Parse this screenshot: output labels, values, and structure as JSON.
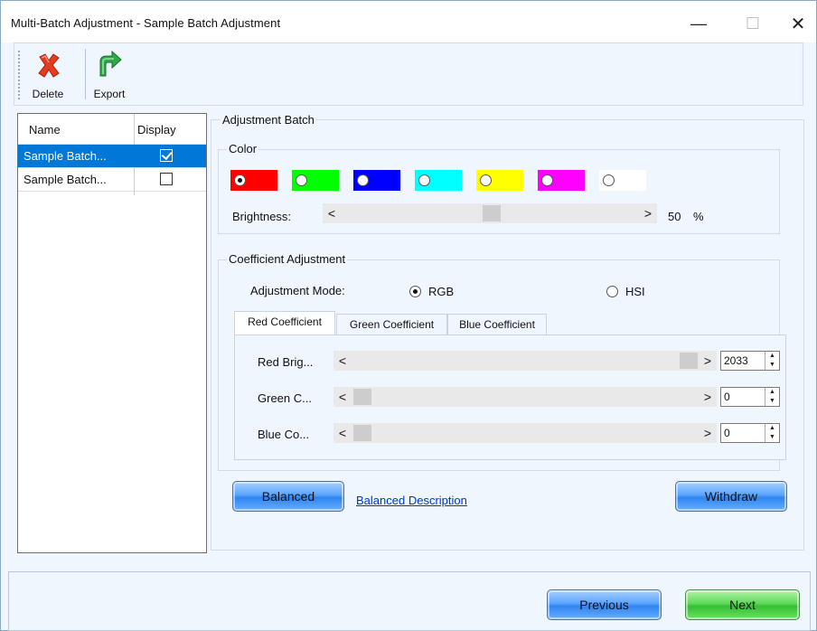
{
  "window": {
    "title": "Multi-Batch Adjustment - Sample Batch Adjustment",
    "min_glyph": "—",
    "max_glyph": "☐",
    "close_glyph": "✕"
  },
  "toolbar": {
    "delete_label": "Delete",
    "export_label": "Export"
  },
  "batch_list": {
    "col_name": "Name",
    "col_display": "Display",
    "rows": [
      {
        "name": "Sample Batch...",
        "display": true,
        "selected": true
      },
      {
        "name": "Sample Batch...",
        "display": false,
        "selected": false
      }
    ]
  },
  "adjustment_batch": {
    "title": "Adjustment Batch",
    "color": {
      "title": "Color",
      "swatches": [
        {
          "color": "#ff0000",
          "selected": true
        },
        {
          "color": "#00ff00",
          "selected": false
        },
        {
          "color": "#0000ff",
          "selected": false
        },
        {
          "color": "#00ffff",
          "selected": false
        },
        {
          "color": "#ffff00",
          "selected": false
        },
        {
          "color": "#ff00ff",
          "selected": false
        },
        {
          "color": "#ffffff",
          "selected": false
        }
      ],
      "brightness_label": "Brightness:",
      "brightness_value": "50",
      "brightness_unit": "%"
    },
    "coefficient": {
      "title": "Coefficient Adjustment",
      "mode_label": "Adjustment Mode:",
      "mode_rgb": "RGB",
      "mode_hsi": "HSI",
      "mode_selected": "RGB",
      "tabs": [
        "Red Coefficient",
        "Green Coefficient",
        "Blue Coefficient"
      ],
      "active_tab": 0,
      "rows": [
        {
          "label": "Red Brig...",
          "value": "2033"
        },
        {
          "label": "Green C...",
          "value": "0"
        },
        {
          "label": "Blue Co...",
          "value": "0"
        }
      ]
    },
    "balanced_label": "Balanced",
    "balanced_description": "Balanced Description",
    "withdraw_label": "Withdraw"
  },
  "footer": {
    "previous_label": "Previous",
    "next_label": "Next"
  },
  "glyphs": {
    "left_arrow": "<",
    "right_arrow": ">",
    "spin_up": "▲",
    "spin_down": "▼"
  }
}
